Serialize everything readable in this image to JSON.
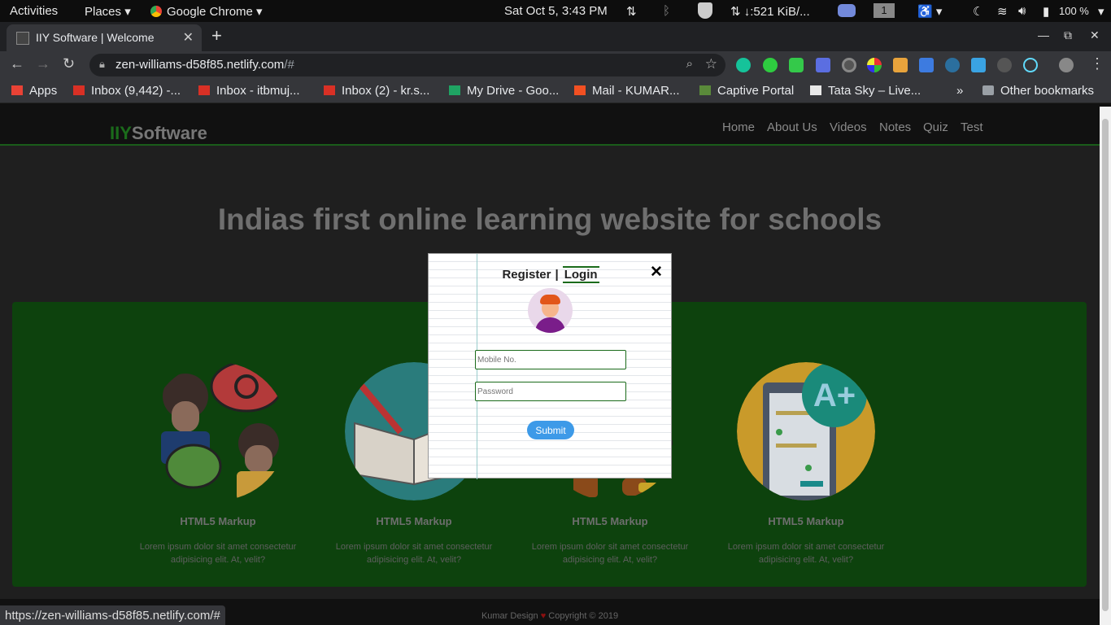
{
  "system_bar": {
    "activities": "Activities",
    "places": "Places",
    "app": "Google Chrome",
    "clock": "Sat Oct  5,  3:43 PM",
    "net_speed": "↓:521 KiB/...",
    "workspace": "1",
    "battery": "100 %"
  },
  "browser": {
    "tab_title": "IIY Software | Welcome",
    "url_host": "zen-williams-d58f85.netlify.com",
    "url_rest": "/#",
    "bookmarks": [
      {
        "label": "Apps",
        "color": "#e94235"
      },
      {
        "label": "Inbox (9,442) -...",
        "color": "#d93025"
      },
      {
        "label": "Inbox - itbmuj...",
        "color": "#d93025"
      },
      {
        "label": "Inbox (2) - kr.s...",
        "color": "#d93025"
      },
      {
        "label": "My Drive - Goo...",
        "color": "#1fa463"
      },
      {
        "label": "Mail - KUMAR...",
        "color": "#f25022"
      },
      {
        "label": "Captive Portal",
        "color": "#5a8a3a"
      },
      {
        "label": "Tata Sky – Live...",
        "color": "#e8e8e8"
      }
    ],
    "more_bookmarks": "»",
    "other_bookmarks": "Other bookmarks",
    "status_url": "https://zen-williams-d58f85.netlify.com/#"
  },
  "site": {
    "logo_accent": "IIY",
    "logo_rest": "Software",
    "nav": [
      "Home",
      "About Us",
      "Videos",
      "Notes",
      "Quiz",
      "Test"
    ],
    "hero": "Indias first online learning website for schools",
    "cards": [
      {
        "title": "HTML5 Markup",
        "text": "Lorem ipsum dolor sit amet consectetur adipisicing elit. At, velit?"
      },
      {
        "title": "HTML5 Markup",
        "text": "Lorem ipsum dolor sit amet consectetur adipisicing elit. At, velit?"
      },
      {
        "title": "HTML5 Markup",
        "text": "Lorem ipsum dolor sit amet consectetur adipisicing elit. At, velit?"
      },
      {
        "title": "HTML5 Markup",
        "text": "Lorem ipsum dolor sit amet consectetur adipisicing elit. At, velit?"
      }
    ],
    "footer_left": "Kumar Design",
    "footer_right": "Copyright © 2019"
  },
  "modal": {
    "tab_register": "Register",
    "tab_separator": "|",
    "tab_login": "Login",
    "close": "✕",
    "mobile_placeholder": "Mobile No.",
    "password_placeholder": "Password",
    "submit": "Submit"
  },
  "colors": {
    "accent_green": "#1b6b1b",
    "panel_green": "#0d420d",
    "submit_blue": "#3d9ae8"
  }
}
